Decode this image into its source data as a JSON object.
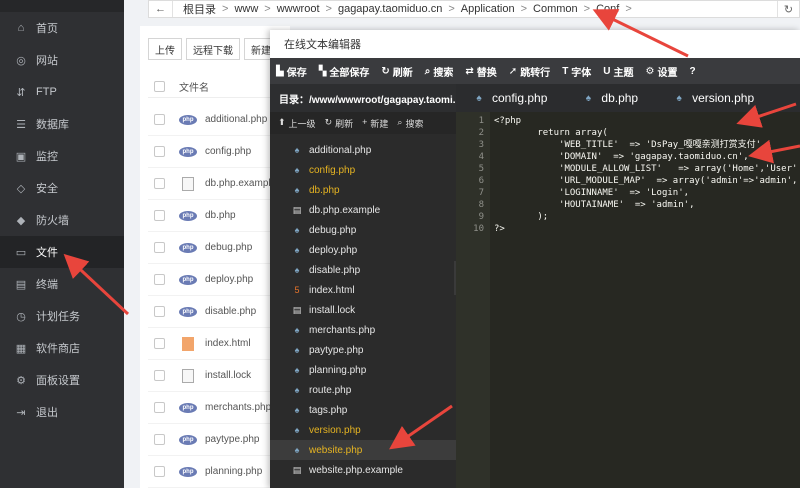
{
  "sidebar": {
    "items": [
      {
        "label": "首页",
        "icon": "home-icon",
        "glyph": "⌂"
      },
      {
        "label": "网站",
        "icon": "globe-icon",
        "glyph": "◎"
      },
      {
        "label": "FTP",
        "icon": "ftp-icon",
        "glyph": "⇵"
      },
      {
        "label": "数据库",
        "icon": "database-icon",
        "glyph": "☰"
      },
      {
        "label": "监控",
        "icon": "monitor-icon",
        "glyph": "▣"
      },
      {
        "label": "安全",
        "icon": "shield-icon",
        "glyph": "◇"
      },
      {
        "label": "防火墙",
        "icon": "firewall-icon",
        "glyph": "◆"
      },
      {
        "label": "文件",
        "icon": "folder-icon",
        "glyph": "▭"
      },
      {
        "label": "终端",
        "icon": "terminal-icon",
        "glyph": "▤"
      },
      {
        "label": "计划任务",
        "icon": "clock-icon",
        "glyph": "◷"
      },
      {
        "label": "软件商店",
        "icon": "apps-icon",
        "glyph": "▦"
      },
      {
        "label": "面板设置",
        "icon": "settings-icon",
        "glyph": "⚙"
      },
      {
        "label": "退出",
        "icon": "logout-icon",
        "glyph": "⇥"
      }
    ],
    "active": "文件"
  },
  "breadcrumb": {
    "back_glyph": "←",
    "crumbs": [
      "根目录",
      "www",
      "wwwroot",
      "gagapay.taomiduo.cn",
      "Application",
      "Common",
      "Conf"
    ],
    "separator": ">",
    "refresh_glyph": "↻"
  },
  "file_manager": {
    "toolbar": {
      "upload": "上传",
      "remote_download": "远程下载",
      "new": "新建∨"
    },
    "column_header": "文件名",
    "rows": [
      {
        "name": "additional.php",
        "type": "php"
      },
      {
        "name": "config.php",
        "type": "php"
      },
      {
        "name": "db.php.example",
        "type": "doc"
      },
      {
        "name": "db.php",
        "type": "php"
      },
      {
        "name": "debug.php",
        "type": "php"
      },
      {
        "name": "deploy.php",
        "type": "php"
      },
      {
        "name": "disable.php",
        "type": "php"
      },
      {
        "name": "index.html",
        "type": "html"
      },
      {
        "name": "install.lock",
        "type": "doc"
      },
      {
        "name": "merchants.php",
        "type": "php"
      },
      {
        "name": "paytype.php",
        "type": "php"
      },
      {
        "name": "planning.php",
        "type": "php"
      }
    ],
    "php_badge": "php"
  },
  "editor": {
    "title": "在线文本编辑器",
    "toolbar": [
      {
        "label": "保存",
        "icon": "save-icon",
        "glyph": "▙"
      },
      {
        "label": "全部保存",
        "icon": "save-all-icon",
        "glyph": "▚"
      },
      {
        "label": "刷新",
        "icon": "refresh-icon",
        "glyph": "↻"
      },
      {
        "label": "搜索",
        "icon": "search-icon",
        "glyph": "⌕"
      },
      {
        "label": "替换",
        "icon": "replace-icon",
        "glyph": "⇄"
      },
      {
        "label": "跳转行",
        "icon": "goto-line-icon",
        "glyph": "➚"
      },
      {
        "label": "字体",
        "icon": "font-icon",
        "glyph": "T"
      },
      {
        "label": "主题",
        "icon": "theme-icon",
        "glyph": "U"
      },
      {
        "label": "设置",
        "icon": "gear-icon",
        "glyph": "⚙"
      },
      {
        "label": "",
        "icon": "help-icon",
        "glyph": "?"
      }
    ],
    "dir_label": "目录：/www/wwwroot/gagapay.taomi...",
    "dir_actions": [
      {
        "label": "上一级",
        "glyph": "⬆"
      },
      {
        "label": "刷新",
        "glyph": "↻"
      },
      {
        "label": "新建",
        "glyph": "+"
      },
      {
        "label": "搜索",
        "glyph": "⌕"
      }
    ],
    "tree": [
      {
        "name": "additional.php",
        "icon": "php"
      },
      {
        "name": "config.php",
        "icon": "php",
        "state": "changed"
      },
      {
        "name": "db.php",
        "icon": "php",
        "state": "changed"
      },
      {
        "name": "db.php.example",
        "icon": "doc"
      },
      {
        "name": "debug.php",
        "icon": "php"
      },
      {
        "name": "deploy.php",
        "icon": "php"
      },
      {
        "name": "disable.php",
        "icon": "php"
      },
      {
        "name": "index.html",
        "icon": "html"
      },
      {
        "name": "install.lock",
        "icon": "doc"
      },
      {
        "name": "merchants.php",
        "icon": "php"
      },
      {
        "name": "paytype.php",
        "icon": "php"
      },
      {
        "name": "planning.php",
        "icon": "php"
      },
      {
        "name": "route.php",
        "icon": "php"
      },
      {
        "name": "tags.php",
        "icon": "php"
      },
      {
        "name": "version.php",
        "icon": "php",
        "state": "changed"
      },
      {
        "name": "website.php",
        "icon": "php",
        "state": "changed-selected"
      },
      {
        "name": "website.php.example",
        "icon": "doc"
      }
    ],
    "collapse_glyph": "‹",
    "tabs": [
      "config.php",
      "db.php",
      "version.php"
    ],
    "line_numbers": [
      "1",
      "2",
      "3",
      "4",
      "5",
      "6",
      "7",
      "8",
      "9",
      "10"
    ],
    "code_lines": [
      "<?php",
      "        return array(",
      "            'WEB_TITLE'  => 'DsPay_嘎嘎亲测打赏支付',",
      "            'DOMAIN'  => 'gagapay.taomiduo.cn',",
      "            'MODULE_ALLOW_LIST'   => array('Home','User'",
      "            'URL_MODULE_MAP'  => array('admin'=>'admin',",
      "            'LOGINNAME'  => 'Login',",
      "            'HOUTAINAME'  => 'admin',",
      "        );",
      "?>"
    ]
  },
  "colors": {
    "annotation_arrow": "#e8453c",
    "changed_file": "#e6b422"
  }
}
